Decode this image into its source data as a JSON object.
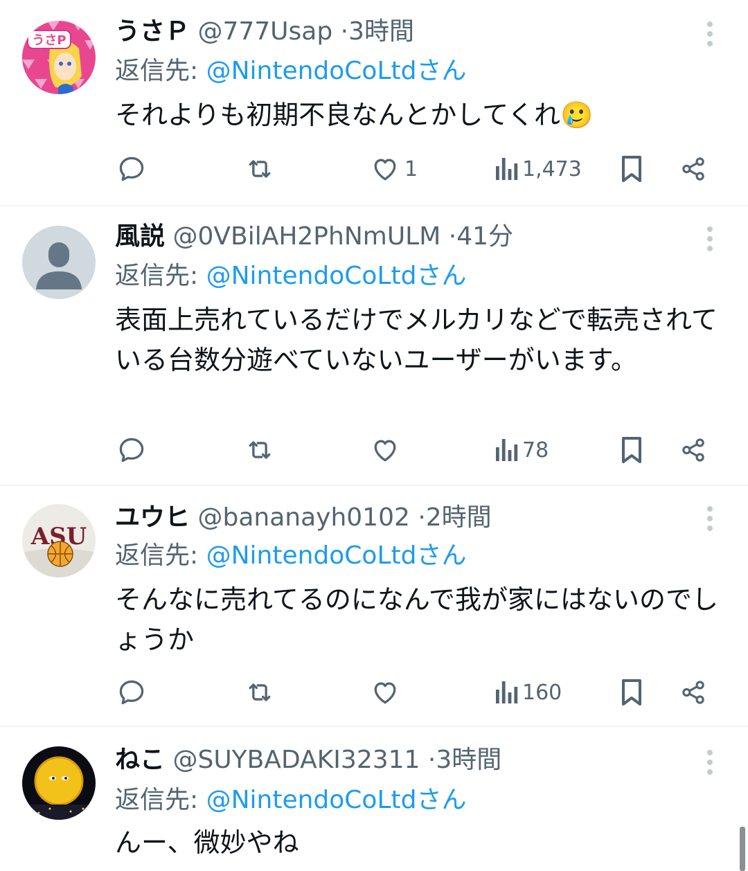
{
  "tweets": [
    {
      "name": "うさＰ",
      "handle": "@777Usap",
      "dot": "·",
      "time": "3時間",
      "reply_label": "返信先: ",
      "reply_mention": "@NintendoCoLtdさん",
      "text": "それよりも初期不良なんとかしてくれ🥲",
      "replies": "",
      "retweets": "",
      "likes": "1",
      "views": "1,473",
      "avatar_desc": "anime-character-avatar"
    },
    {
      "name": "風説",
      "handle": "@0VBilAH2PhNmULM",
      "dot": "·",
      "time": "41分",
      "reply_label": "返信先: ",
      "reply_mention": "@NintendoCoLtdさん",
      "text": "表面上売れているだけでメルカリなどで転売されている台数分遊べていないユーザーがいます。",
      "replies": "",
      "retweets": "",
      "likes": "",
      "views": "78",
      "avatar_desc": "default-user-avatar"
    },
    {
      "name": "ユウヒ",
      "handle": "@bananayh0102",
      "dot": "·",
      "time": "2時間",
      "reply_label": "返信先: ",
      "reply_mention": "@NintendoCoLtdさん",
      "text": "そんなに売れてるのになんで我が家にはないのでしょうか",
      "replies": "",
      "retweets": "",
      "likes": "",
      "views": "160",
      "avatar_desc": "asu-basketball-avatar"
    },
    {
      "name": "ねこ",
      "handle": "@SUYBADAKI32311",
      "dot": "·",
      "time": "3時間",
      "reply_label": "返信先: ",
      "reply_mention": "@NintendoCoLtdさん",
      "text": "んー、微妙やね",
      "avatar_desc": "sphere-avatar"
    }
  ],
  "avatar_text": {
    "usap": "うさP",
    "asu": "ASU"
  },
  "colors": {
    "link": "#1d9bf0",
    "secondary": "#536471",
    "text": "#0f1419",
    "divider": "#eff3f4"
  },
  "icons": [
    "reply-icon",
    "retweet-icon",
    "like-icon",
    "views-icon",
    "bookmark-icon",
    "share-icon",
    "more-icon"
  ]
}
